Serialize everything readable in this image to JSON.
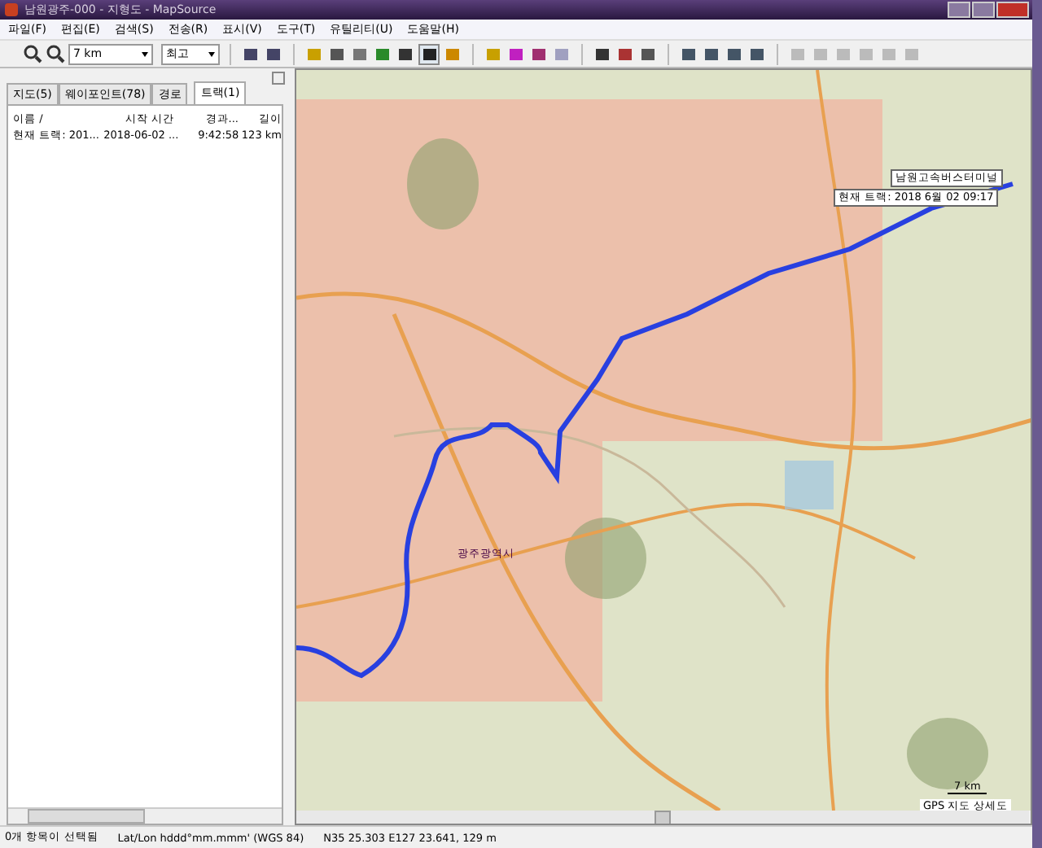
{
  "window": {
    "title": "남원광주-000 - 지형도 - MapSource"
  },
  "menu": [
    "파일(F)",
    "편집(E)",
    "검색(S)",
    "전송(R)",
    "표시(V)",
    "도구(T)",
    "유틸리티(U)",
    "도움말(H)"
  ],
  "toolbar": {
    "zoom_scale": "7 km",
    "detail": "최고"
  },
  "tabs": [
    {
      "label": "지도(5)",
      "selected": false
    },
    {
      "label": "웨이포인트(78)",
      "selected": false
    },
    {
      "label": "경로",
      "selected": false
    },
    {
      "label": "트랙(1)",
      "selected": true
    }
  ],
  "table": {
    "columns": [
      "이름 /",
      "시작 시간",
      "경과...",
      "길이"
    ],
    "rows": [
      [
        "현재 트랙: 201...",
        "2018-06-02 ...",
        "9:42:58",
        "123 km"
      ]
    ]
  },
  "map": {
    "labels": [
      {
        "kind": "waypoint",
        "text": "남원고속버스터미널"
      },
      {
        "kind": "info",
        "text": "현재 트랙: 2018 6월 02 09:17"
      },
      {
        "kind": "city",
        "text": "광주광역시"
      }
    ],
    "scale": "7 km",
    "credit": "GPS 지도 상세도"
  },
  "status_bar": [
    "0개 항목이 선택됨",
    "Lat/Lon hddd°mm.mmm' (WGS 84)",
    "N35 25.303 E127 23.641, 129 m"
  ]
}
